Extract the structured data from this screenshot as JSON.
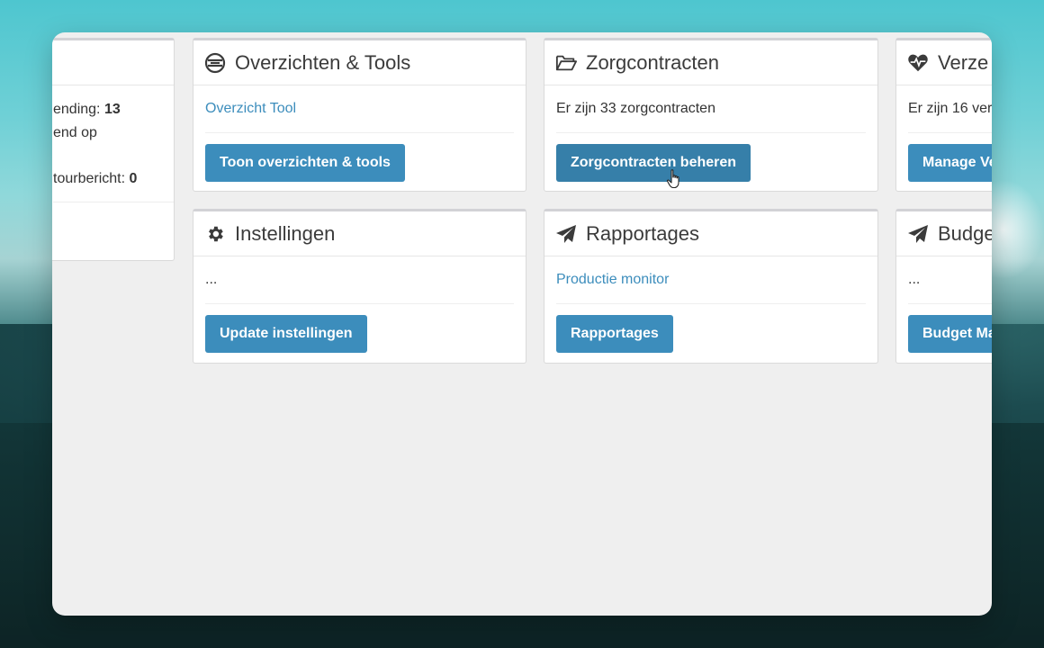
{
  "left_panel": {
    "line1_text": "ending: ",
    "line1_value": "13",
    "line2_text": "end op",
    "line3_text": "tourbericht: ",
    "line3_value": "0"
  },
  "panels": [
    {
      "title": "Overzichten & Tools",
      "icon": "circle-lines-icon",
      "item": "Overzicht Tool",
      "item_is_link": true,
      "button": "Toon overzichten & tools"
    },
    {
      "title": "Zorgcontracten",
      "icon": "folder-open-icon",
      "item": "Er zijn 33 zorgcontracten",
      "item_is_link": false,
      "button": "Zorgcontracten beheren"
    },
    {
      "title": "Verze",
      "icon": "heartbeat-icon",
      "item": "Er zijn 16 ver",
      "item_is_link": false,
      "button": "Manage Ve"
    },
    {
      "title": "Instellingen",
      "icon": "gear-icon",
      "item": "...",
      "item_is_link": false,
      "button": "Update instellingen"
    },
    {
      "title": "Rapportages",
      "icon": "paper-plane-icon",
      "item": "Productie monitor",
      "item_is_link": true,
      "button": "Rapportages"
    },
    {
      "title": "Budge",
      "icon": "paper-plane-icon",
      "item": "...",
      "item_is_link": false,
      "button": "Budget Ma"
    }
  ],
  "colors": {
    "primary": "#3c8dbc",
    "primary_active": "#367fa9",
    "panel_bg": "#ffffff",
    "window_bg": "#efefef"
  }
}
